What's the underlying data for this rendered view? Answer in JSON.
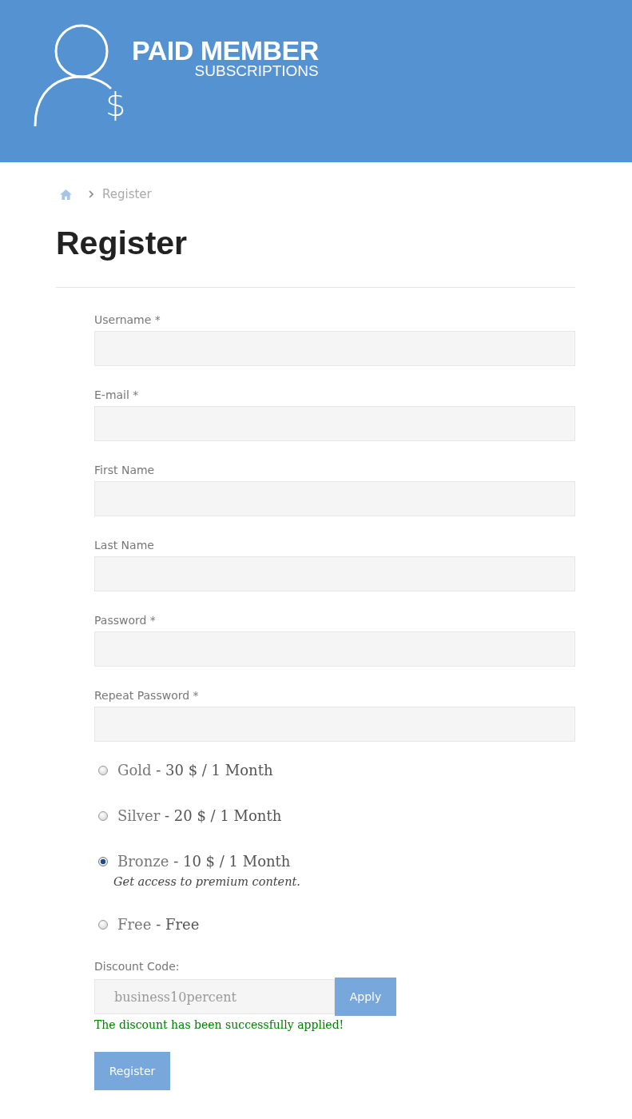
{
  "header": {
    "logo": {
      "title": "PAID MEMBER",
      "subtitle": "SUBSCRIPTIONS",
      "symbol": "$"
    }
  },
  "breadcrumb": {
    "current": "Register"
  },
  "page_title": "Register",
  "fields": [
    {
      "label": "Username *"
    },
    {
      "label": "E-mail *"
    },
    {
      "label": "First Name"
    },
    {
      "label": "Last Name"
    },
    {
      "label": "Password *"
    },
    {
      "label": "Repeat Password *"
    }
  ],
  "plans": [
    {
      "name": "Gold",
      "details": "- 30 $ / 1 Month",
      "selected": false
    },
    {
      "name": "Silver",
      "details": "- 20 $ / 1 Month",
      "selected": false
    },
    {
      "name": "Bronze",
      "details": "- 10 $ / 1 Month",
      "description": "Get access to premium content.",
      "selected": true
    },
    {
      "name": "Free",
      "details": "- Free",
      "selected": false
    }
  ],
  "discount": {
    "label": "Discount Code:",
    "value": "business10percent",
    "button": "Apply",
    "message": "The discount has been successfully applied!"
  },
  "submit": "Register"
}
